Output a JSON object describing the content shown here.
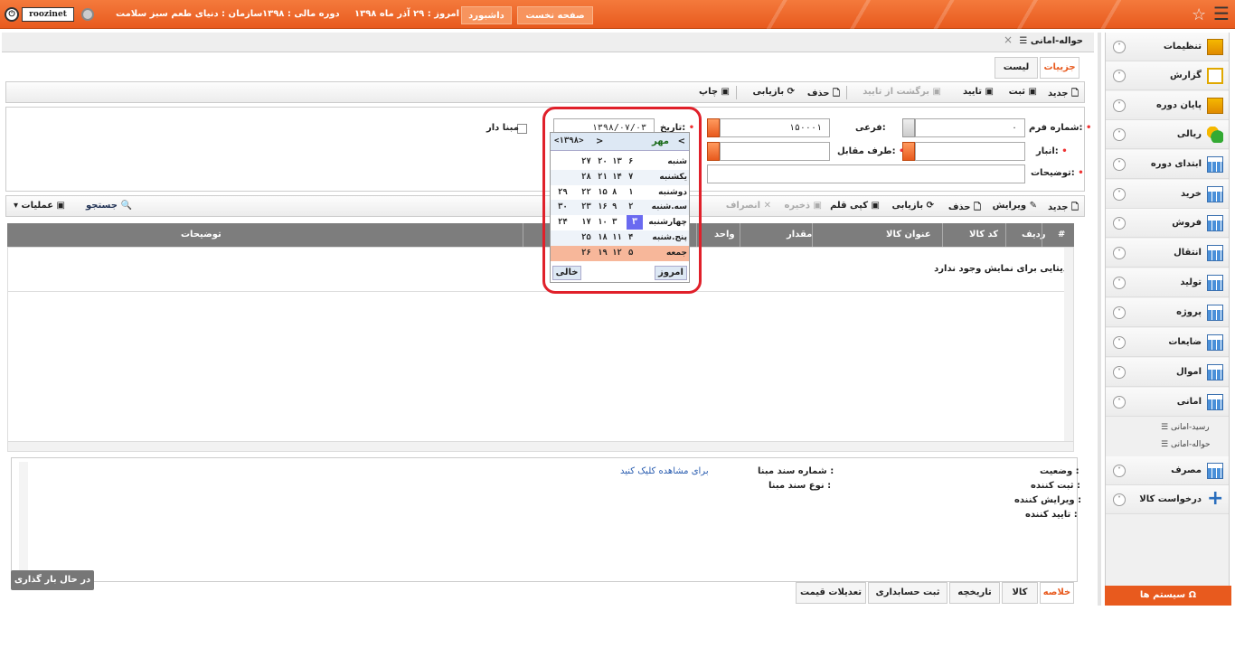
{
  "topbar": {
    "user": "roozinet",
    "org": "سازمان : دنیای طعم سبز سلامت",
    "fiscal": "دوره مالی : ۱۳۹۸",
    "today": "امروز : ۲۹ آذر ماه ۱۳۹۸",
    "dashboard": "داشبورد",
    "home": "صفحه نخست",
    "accent": "#e85a1e"
  },
  "sidebar": {
    "items": [
      {
        "label": "تنظیمات",
        "icon": "settings-folder-icon"
      },
      {
        "label": "گزارش",
        "icon": "report-icon"
      },
      {
        "label": "پایان دوره",
        "icon": "period-end-icon"
      },
      {
        "label": "ریالی",
        "icon": "money-icon"
      },
      {
        "label": "ابتدای دوره",
        "icon": "grid-icon"
      },
      {
        "label": "خرید",
        "icon": "grid-icon"
      },
      {
        "label": "فروش",
        "icon": "grid-icon"
      },
      {
        "label": "انتقال",
        "icon": "grid-icon"
      },
      {
        "label": "تولید",
        "icon": "grid-icon"
      },
      {
        "label": "پروژه",
        "icon": "grid-icon"
      },
      {
        "label": "ضایعات",
        "icon": "grid-icon"
      },
      {
        "label": "اموال",
        "icon": "grid-icon"
      },
      {
        "label": "امانی",
        "icon": "grid-icon"
      },
      {
        "label": "مصرف",
        "icon": "grid-icon"
      },
      {
        "label": "درخواست کالا",
        "icon": "plus-icon"
      }
    ],
    "subitems": [
      "رسید-امانی",
      "حواله-امانی"
    ],
    "system": "سیستم ها"
  },
  "page": {
    "tab_title": "حواله-امانی",
    "subtabs": [
      "جزییات",
      "لیست"
    ]
  },
  "toolbar1": [
    "جدید",
    "ثبت",
    "تایید",
    "برگشت از تایید",
    "حذف",
    "بازیابی",
    "چاپ"
  ],
  "form": {
    "form_no_label": "شماره فرم:",
    "form_no_value": "۰",
    "sub_label": "فرعی:",
    "sub_value": "۱۵۰۰۰۱",
    "date_label": "تاریخ:",
    "date_value": "۱۳۹۸/۰۷/۰۳",
    "warehouse_label": "انبار:",
    "party_label": "طرف مقابل:",
    "desc_label": "توضیحات:",
    "based_label": "مبنا دار"
  },
  "toolbar2": [
    "جدید",
    "ویرایش",
    "حذف",
    "بازیابی",
    "کپی قلم",
    "ذخیره",
    "انصراف",
    "جستجو",
    "عملیات"
  ],
  "grid": {
    "columns": [
      "#",
      "ردیف",
      "کد کالا",
      "عنوان کالا",
      "مقدار",
      "واحد",
      "توضیحات"
    ],
    "empty": "دیتایی برای نمایش وجود ندارد"
  },
  "details": {
    "status": "وضعیت :",
    "creator": "ثبت کننده :",
    "editor": "ویرایش کننده :",
    "approver": "تایید کننده :",
    "base_no": "شماره سند مبنا :",
    "base_type": "نوع سند مبنا :",
    "click": "برای مشاهده کلیک کنید"
  },
  "bottom_tabs": [
    "خلاصه",
    "کالا",
    "تاریخچه",
    "ثبت حسابداری",
    "تعدیلات قیمت"
  ],
  "loading": "در حال بار گذاری ...",
  "calendar": {
    "month": "مهر",
    "year": "۱۳۹۸",
    "days": [
      "شنبه",
      "یکشنبه",
      "دوشنبه",
      "سه.شنبه",
      "چهارشنبه",
      "پنج.شنبه",
      "جمعه"
    ],
    "weeks": [
      [
        "۶",
        "۷",
        "۱",
        "۲",
        "",
        "۴",
        "۵"
      ],
      [
        "۱۳",
        "۱۴",
        "۸",
        "۹",
        "۳",
        "۱۱",
        "۱۲"
      ],
      [
        "۲۰",
        "۲۱",
        "۱۵",
        "۱۶",
        "۱۰",
        "۱۸",
        "۱۹"
      ],
      [
        "۲۷",
        "۲۸",
        "۲۲",
        "۲۳",
        "۱۷",
        "۲۵",
        "۲۶"
      ],
      [
        "",
        "",
        "۲۹",
        "۳۰",
        "۲۴",
        "",
        ""
      ]
    ],
    "selected": "۳",
    "today_btn": "امروز",
    "clear_btn": "خالی"
  }
}
